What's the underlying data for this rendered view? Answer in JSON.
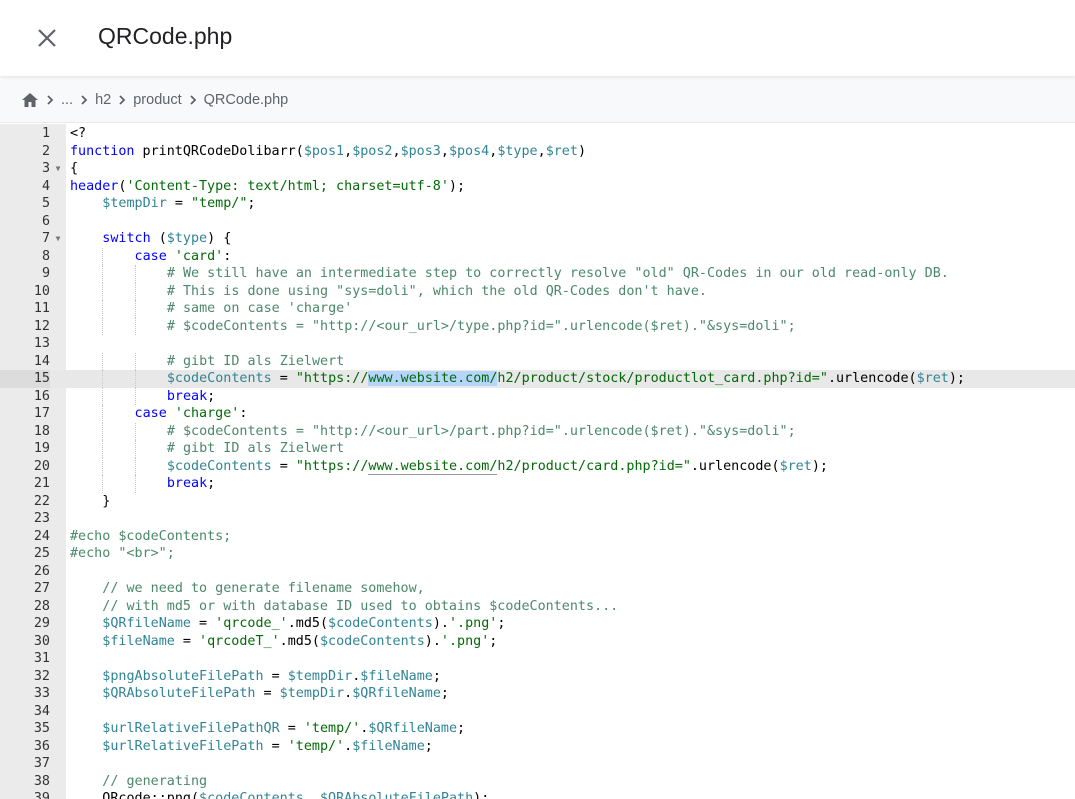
{
  "header": {
    "title": "QRCode.php",
    "close_icon": "close-icon"
  },
  "breadcrumb": {
    "home_icon": "home-icon",
    "items": [
      "...",
      "h2",
      "product",
      "QRCode.php"
    ]
  },
  "editor": {
    "active_line": 15,
    "lines": [
      {
        "n": "1",
        "indent": 0,
        "fold": false,
        "tokens": [
          [
            "plain",
            "<?"
          ]
        ]
      },
      {
        "n": "2",
        "indent": 0,
        "fold": false,
        "tokens": [
          [
            "kw",
            "function"
          ],
          [
            "plain",
            " printQRCodeDolibarr("
          ],
          [
            "var",
            "$pos1"
          ],
          [
            "plain",
            ","
          ],
          [
            "var",
            "$pos2"
          ],
          [
            "plain",
            ","
          ],
          [
            "var",
            "$pos3"
          ],
          [
            "plain",
            ","
          ],
          [
            "var",
            "$pos4"
          ],
          [
            "plain",
            ","
          ],
          [
            "var",
            "$type"
          ],
          [
            "plain",
            ","
          ],
          [
            "var",
            "$ret"
          ],
          [
            "plain",
            ")"
          ]
        ]
      },
      {
        "n": "3",
        "indent": 0,
        "fold": true,
        "tokens": [
          [
            "plain",
            "{"
          ]
        ]
      },
      {
        "n": "4",
        "indent": 0,
        "fold": false,
        "tokens": [
          [
            "kw",
            "header"
          ],
          [
            "plain",
            "("
          ],
          [
            "str",
            "'Content-Type: text/html; charset=utf-8'"
          ],
          [
            "plain",
            ");"
          ]
        ]
      },
      {
        "n": "5",
        "indent": 1,
        "fold": false,
        "tokens": [
          [
            "var",
            "$tempDir"
          ],
          [
            "plain",
            " = "
          ],
          [
            "str",
            "\"temp/\""
          ],
          [
            "plain",
            ";"
          ]
        ]
      },
      {
        "n": "6",
        "indent": 0,
        "fold": false,
        "tokens": []
      },
      {
        "n": "7",
        "indent": 1,
        "fold": true,
        "tokens": [
          [
            "kw",
            "switch"
          ],
          [
            "plain",
            " ("
          ],
          [
            "var",
            "$type"
          ],
          [
            "plain",
            ") {"
          ]
        ]
      },
      {
        "n": "8",
        "indent": 2,
        "fold": false,
        "tokens": [
          [
            "kw",
            "case"
          ],
          [
            "plain",
            " "
          ],
          [
            "str",
            "'card'"
          ],
          [
            "plain",
            ":"
          ]
        ]
      },
      {
        "n": "9",
        "indent": 3,
        "fold": false,
        "tokens": [
          [
            "cmt",
            "# We still have an intermediate step to correctly resolve \"old\" QR-Codes in our old read-only DB."
          ]
        ]
      },
      {
        "n": "10",
        "indent": 3,
        "fold": false,
        "tokens": [
          [
            "cmt",
            "# This is done using \"sys=doli\", which the old QR-Codes don't have."
          ]
        ]
      },
      {
        "n": "11",
        "indent": 3,
        "fold": false,
        "tokens": [
          [
            "cmt",
            "# same on case 'charge'"
          ]
        ]
      },
      {
        "n": "12",
        "indent": 3,
        "fold": false,
        "tokens": [
          [
            "cmt",
            "# $codeContents = \"http://<our_url>/type.php?id=\".urlencode($ret).\"&sys=doli\";"
          ]
        ]
      },
      {
        "n": "13",
        "indent": 0,
        "fold": false,
        "tokens": []
      },
      {
        "n": "14",
        "indent": 3,
        "fold": false,
        "tokens": [
          [
            "cmt",
            "# gibt ID als Zielwert"
          ]
        ]
      },
      {
        "n": "15",
        "indent": 3,
        "fold": false,
        "tokens": [
          [
            "var",
            "$codeContents"
          ],
          [
            "plain",
            " = "
          ],
          [
            "str",
            "\"https://"
          ],
          [
            "strsel",
            "www.website.com/"
          ],
          [
            "str",
            "h2/product/stock/productlot_card.php?id=\""
          ],
          [
            "plain",
            ".urlencode("
          ],
          [
            "var",
            "$ret"
          ],
          [
            "plain",
            ");"
          ]
        ]
      },
      {
        "n": "16",
        "indent": 3,
        "fold": false,
        "tokens": [
          [
            "kw",
            "break"
          ],
          [
            "plain",
            ";"
          ]
        ]
      },
      {
        "n": "17",
        "indent": 2,
        "fold": false,
        "tokens": [
          [
            "kw",
            "case"
          ],
          [
            "plain",
            " "
          ],
          [
            "str",
            "'charge'"
          ],
          [
            "plain",
            ":"
          ]
        ]
      },
      {
        "n": "18",
        "indent": 3,
        "fold": false,
        "tokens": [
          [
            "cmt",
            "# $codeContents = \"http://<our_url>/part.php?id=\".urlencode($ret).\"&sys=doli\";"
          ]
        ]
      },
      {
        "n": "19",
        "indent": 3,
        "fold": false,
        "tokens": [
          [
            "cmt",
            "# gibt ID als Zielwert"
          ]
        ]
      },
      {
        "n": "20",
        "indent": 3,
        "fold": false,
        "tokens": [
          [
            "var",
            "$codeContents"
          ],
          [
            "plain",
            " = "
          ],
          [
            "str",
            "\"https://"
          ],
          [
            "strurl",
            "www.website.com/"
          ],
          [
            "str",
            "h2/product/card.php?id=\""
          ],
          [
            "plain",
            ".urlencode("
          ],
          [
            "var",
            "$ret"
          ],
          [
            "plain",
            ");"
          ]
        ]
      },
      {
        "n": "21",
        "indent": 3,
        "fold": false,
        "tokens": [
          [
            "kw",
            "break"
          ],
          [
            "plain",
            ";"
          ]
        ]
      },
      {
        "n": "22",
        "indent": 1,
        "fold": false,
        "tokens": [
          [
            "plain",
            "}"
          ]
        ]
      },
      {
        "n": "23",
        "indent": 0,
        "fold": false,
        "tokens": []
      },
      {
        "n": "24",
        "indent": 0,
        "fold": false,
        "tokens": [
          [
            "cmt",
            "#echo $codeContents;"
          ]
        ]
      },
      {
        "n": "25",
        "indent": 0,
        "fold": false,
        "tokens": [
          [
            "cmt",
            "#echo \"<br>\";"
          ]
        ]
      },
      {
        "n": "26",
        "indent": 0,
        "fold": false,
        "tokens": []
      },
      {
        "n": "27",
        "indent": 1,
        "fold": false,
        "tokens": [
          [
            "cmt",
            "// we need to generate filename somehow,"
          ]
        ]
      },
      {
        "n": "28",
        "indent": 1,
        "fold": false,
        "tokens": [
          [
            "cmt",
            "// with md5 or with database ID used to obtains $codeContents..."
          ]
        ]
      },
      {
        "n": "29",
        "indent": 1,
        "fold": false,
        "tokens": [
          [
            "var",
            "$QRfileName"
          ],
          [
            "plain",
            " = "
          ],
          [
            "str",
            "'qrcode_'"
          ],
          [
            "plain",
            ".md5("
          ],
          [
            "var",
            "$codeContents"
          ],
          [
            "plain",
            ")."
          ],
          [
            "str",
            "'.png'"
          ],
          [
            "plain",
            ";"
          ]
        ]
      },
      {
        "n": "30",
        "indent": 1,
        "fold": false,
        "tokens": [
          [
            "var",
            "$fileName"
          ],
          [
            "plain",
            " = "
          ],
          [
            "str",
            "'qrcodeT_'"
          ],
          [
            "plain",
            ".md5("
          ],
          [
            "var",
            "$codeContents"
          ],
          [
            "plain",
            ")."
          ],
          [
            "str",
            "'.png'"
          ],
          [
            "plain",
            ";"
          ]
        ]
      },
      {
        "n": "31",
        "indent": 0,
        "fold": false,
        "tokens": []
      },
      {
        "n": "32",
        "indent": 1,
        "fold": false,
        "tokens": [
          [
            "var",
            "$pngAbsoluteFilePath"
          ],
          [
            "plain",
            " = "
          ],
          [
            "var",
            "$tempDir"
          ],
          [
            "plain",
            "."
          ],
          [
            "var",
            "$fileName"
          ],
          [
            "plain",
            ";"
          ]
        ]
      },
      {
        "n": "33",
        "indent": 1,
        "fold": false,
        "tokens": [
          [
            "var",
            "$QRAbsoluteFilePath"
          ],
          [
            "plain",
            " = "
          ],
          [
            "var",
            "$tempDir"
          ],
          [
            "plain",
            "."
          ],
          [
            "var",
            "$QRfileName"
          ],
          [
            "plain",
            ";"
          ]
        ]
      },
      {
        "n": "34",
        "indent": 0,
        "fold": false,
        "tokens": []
      },
      {
        "n": "35",
        "indent": 1,
        "fold": false,
        "tokens": [
          [
            "var",
            "$urlRelativeFilePathQR"
          ],
          [
            "plain",
            " = "
          ],
          [
            "str",
            "'temp/'"
          ],
          [
            "plain",
            "."
          ],
          [
            "var",
            "$QRfileName"
          ],
          [
            "plain",
            ";"
          ]
        ]
      },
      {
        "n": "36",
        "indent": 1,
        "fold": false,
        "tokens": [
          [
            "var",
            "$urlRelativeFilePath"
          ],
          [
            "plain",
            " = "
          ],
          [
            "str",
            "'temp/'"
          ],
          [
            "plain",
            "."
          ],
          [
            "var",
            "$fileName"
          ],
          [
            "plain",
            ";"
          ]
        ]
      },
      {
        "n": "37",
        "indent": 0,
        "fold": false,
        "tokens": []
      },
      {
        "n": "38",
        "indent": 1,
        "fold": false,
        "tokens": [
          [
            "cmt",
            "// generating"
          ]
        ]
      },
      {
        "n": "39",
        "indent": 1,
        "fold": false,
        "tokens": [
          [
            "plain",
            "QRcode::png("
          ],
          [
            "var",
            "$codeContents"
          ],
          [
            "plain",
            ", "
          ],
          [
            "var",
            "$QRAbsoluteFilePath"
          ],
          [
            "plain",
            ");"
          ]
        ]
      }
    ]
  }
}
